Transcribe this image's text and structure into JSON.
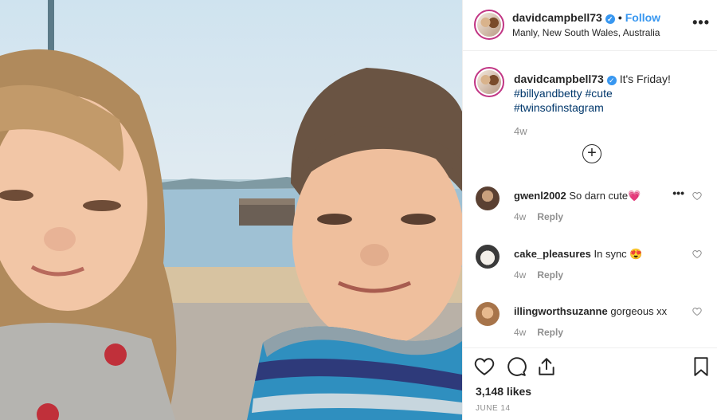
{
  "post": {
    "username": "davidcampbell73",
    "follow_label": "Follow",
    "separator": "•",
    "location": "Manly, New South Wales, Australia",
    "more_glyph": "•••"
  },
  "caption": {
    "username": "davidcampbell73",
    "text": "It's Friday!",
    "hashtags": [
      "#billyandbetty",
      "#cute",
      "#twinsofinstagram"
    ],
    "time": "4w"
  },
  "load_more_glyph": "+",
  "comments": [
    {
      "username": "gwenl2002",
      "text": "So darn cute💗",
      "time": "4w",
      "reply_label": "Reply"
    },
    {
      "username": "cake_pleasures",
      "text": "In sync 😍",
      "time": "4w",
      "reply_label": "Reply"
    },
    {
      "username": "illingworthsuzanne",
      "text": "gorgeous xx",
      "time": "4w",
      "reply_label": "Reply"
    }
  ],
  "comment_more_glyph": "•••",
  "likes": "3,148 likes",
  "date": "JUNE 14",
  "icons": [
    "heart-icon",
    "comment-icon",
    "share-icon",
    "bookmark-icon",
    "verified-badge-icon",
    "plus-circle-icon"
  ],
  "colors": {
    "link": "#3897f0",
    "hashtag": "#00376b",
    "muted": "#8e8e8e",
    "ring": "#c13584"
  }
}
